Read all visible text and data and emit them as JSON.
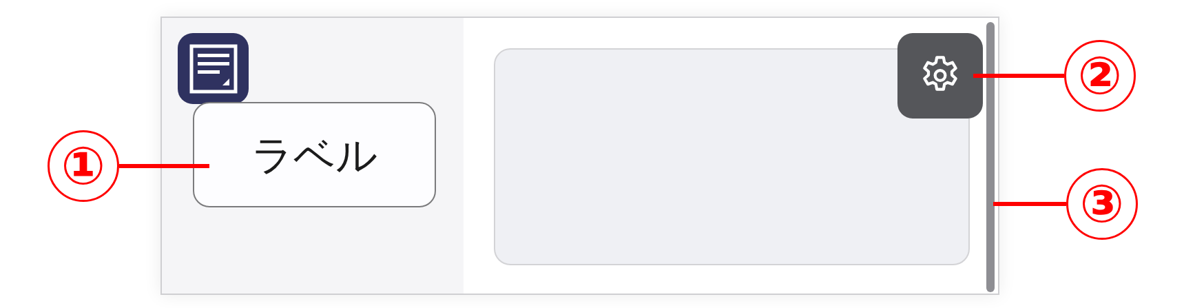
{
  "label_box": {
    "text": "ラベル"
  },
  "callouts": [
    {
      "number": "①"
    },
    {
      "number": "②"
    },
    {
      "number": "③"
    }
  ]
}
